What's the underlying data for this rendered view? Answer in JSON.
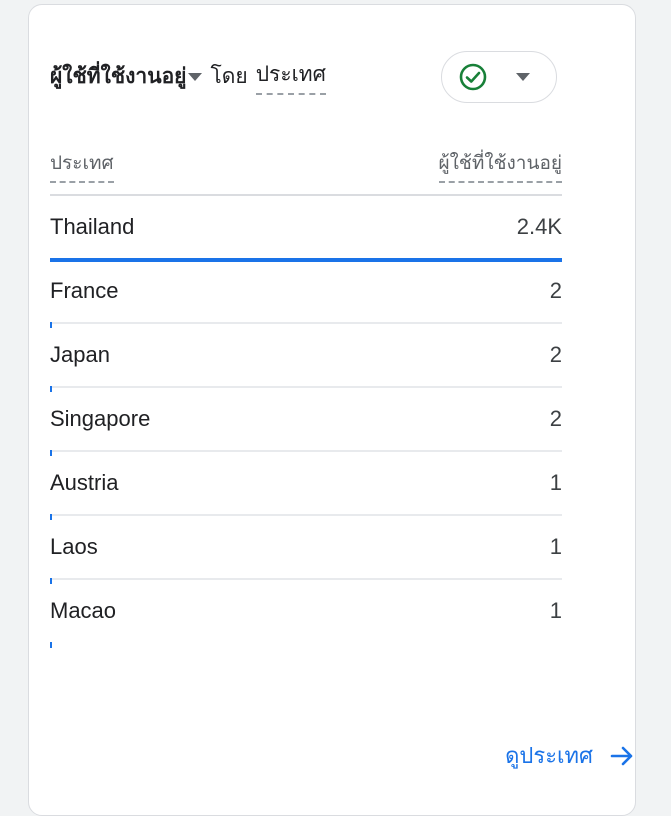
{
  "card": {
    "title_metric": "ผู้ใช้ที่ใช้งานอยู่",
    "title_by": "โดย",
    "title_dimension": "ประเทศ",
    "status_icon": "check-circle-icon",
    "status_color": "#188038"
  },
  "table": {
    "col_dimension": "ประเทศ",
    "col_metric": "ผู้ใช้ที่ใช้งานอยู่",
    "rows": [
      {
        "label": "Thailand",
        "value": "2.4K",
        "share": 1.0
      },
      {
        "label": "France",
        "value": "2",
        "share": 0.001
      },
      {
        "label": "Japan",
        "value": "2",
        "share": 0.001
      },
      {
        "label": "Singapore",
        "value": "2",
        "share": 0.001
      },
      {
        "label": "Austria",
        "value": "1",
        "share": 0.0005
      },
      {
        "label": "Laos",
        "value": "1",
        "share": 0.0005
      },
      {
        "label": "Macao",
        "value": "1",
        "share": 0.0005
      }
    ]
  },
  "footer": {
    "link_label": "ดูประเทศ",
    "link_icon": "arrow-right-icon"
  },
  "colors": {
    "accent": "#1a73e8",
    "success": "#188038"
  }
}
